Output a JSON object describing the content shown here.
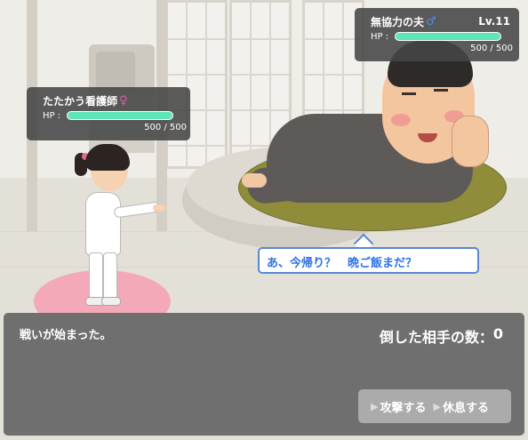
{
  "player": {
    "name": "たたかう看護師",
    "gender_symbol": "♀",
    "gender_color": "#e05aa3",
    "hp_label": "HP :",
    "hp_current": 500,
    "hp_max": 500,
    "hp_text": "500 / 500"
  },
  "enemy": {
    "name": "無協力の夫",
    "gender_symbol": "♂",
    "gender_color": "#4d8ce8",
    "level": "Lv.11",
    "hp_label": "HP :",
    "hp_current": 500,
    "hp_max": 500,
    "hp_text": "500 / 500",
    "speech": "あ、今帰り？　晩ご飯まだ？"
  },
  "message": {
    "text": "戦いが始まった。",
    "defeat_label": "倒した相手の数：",
    "defeat_count": "0"
  },
  "commands": {
    "attack_label": "攻撃する",
    "rest_label": "休息する",
    "arrow_icon": "▶"
  },
  "colors": {
    "hp_fill": "#5ee6b8",
    "player_platform": "#f3a9b8",
    "enemy_platform": "#8f8d3a",
    "speech_text": "#2f73e4"
  }
}
